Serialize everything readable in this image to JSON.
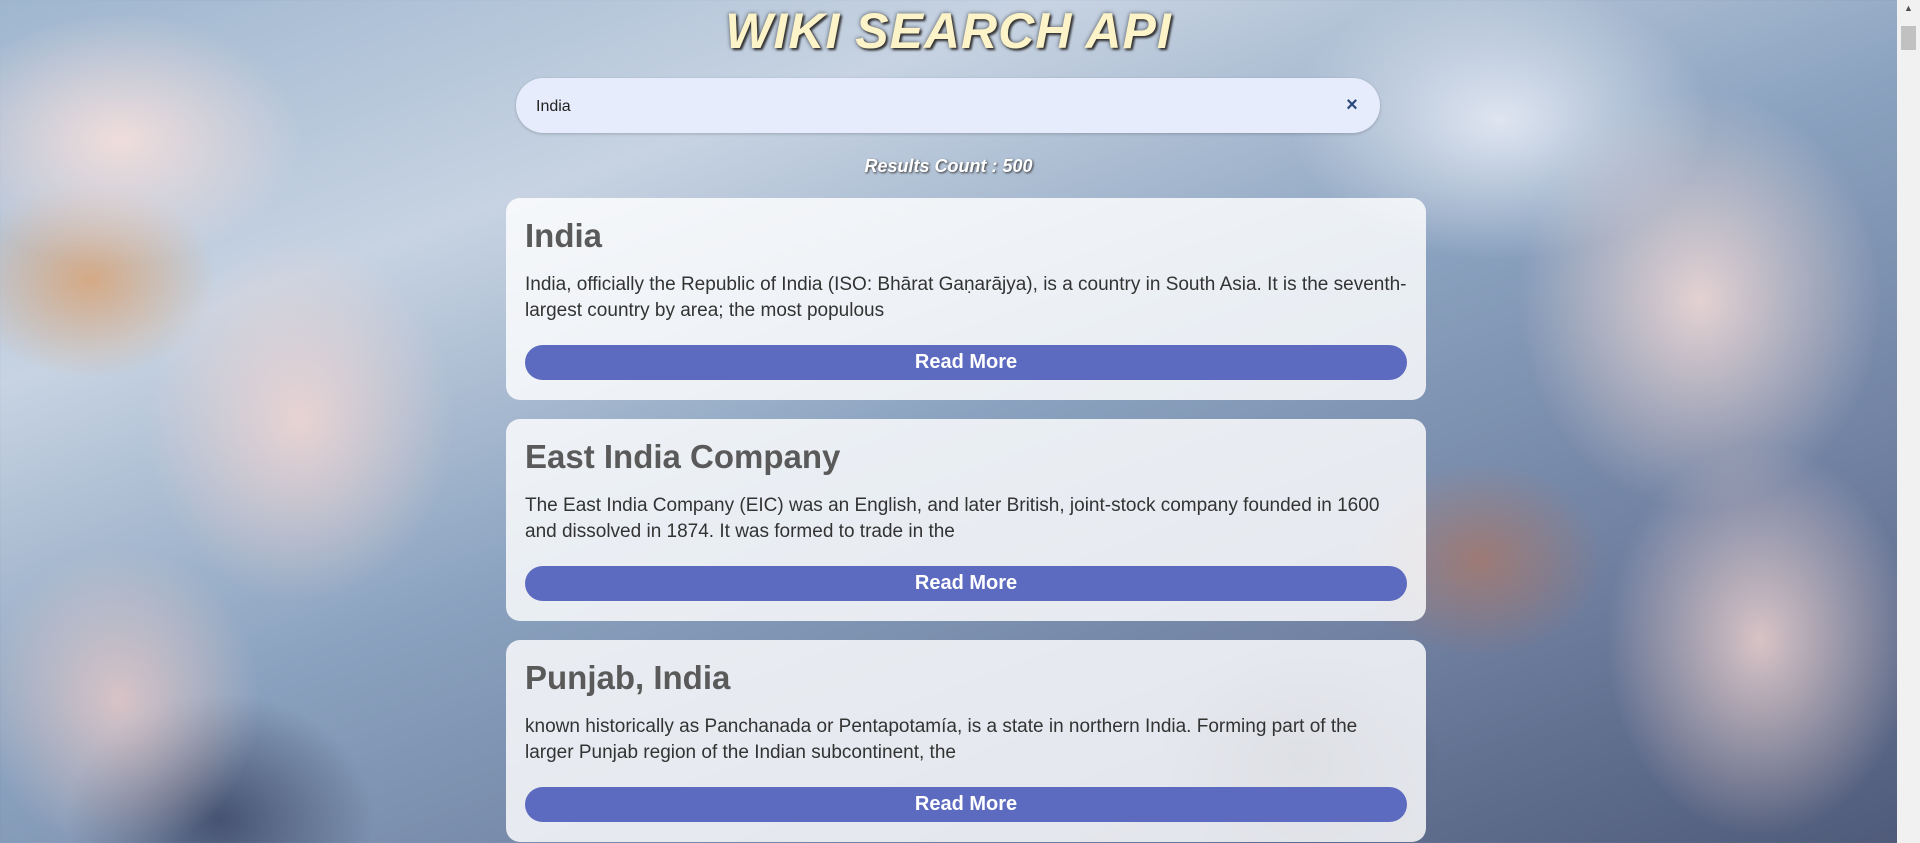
{
  "header": {
    "title": "WIKI SEARCH API"
  },
  "search": {
    "value": "India",
    "placeholder": "",
    "clear_icon": "×"
  },
  "results_count_label": "Results Count : 500",
  "results": [
    {
      "title": "India",
      "snippet": "India, officially the Republic of India (ISO: Bhārat Gaṇarājya), is a country in South Asia. It is the seventh-largest country by area; the most populous",
      "button_label": "Read More"
    },
    {
      "title": "East India Company",
      "snippet": "The East India Company (EIC) was an English, and later British, joint-stock company founded in 1600 and dissolved in 1874. It was formed to trade in the",
      "button_label": "Read More"
    },
    {
      "title": "Punjab, India",
      "snippet": "known historically as Panchanada or Pentapotamía, is a state in northern India. Forming part of the larger Punjab region of the Indian subcontinent, the",
      "button_label": "Read More"
    }
  ],
  "colors": {
    "button": "#5c6bc0",
    "title": "#fdf3c8",
    "search_bg": "#e6ecfb"
  },
  "icons": {
    "clear": "close-icon",
    "scroll_up": "scroll-up-arrow-icon"
  }
}
